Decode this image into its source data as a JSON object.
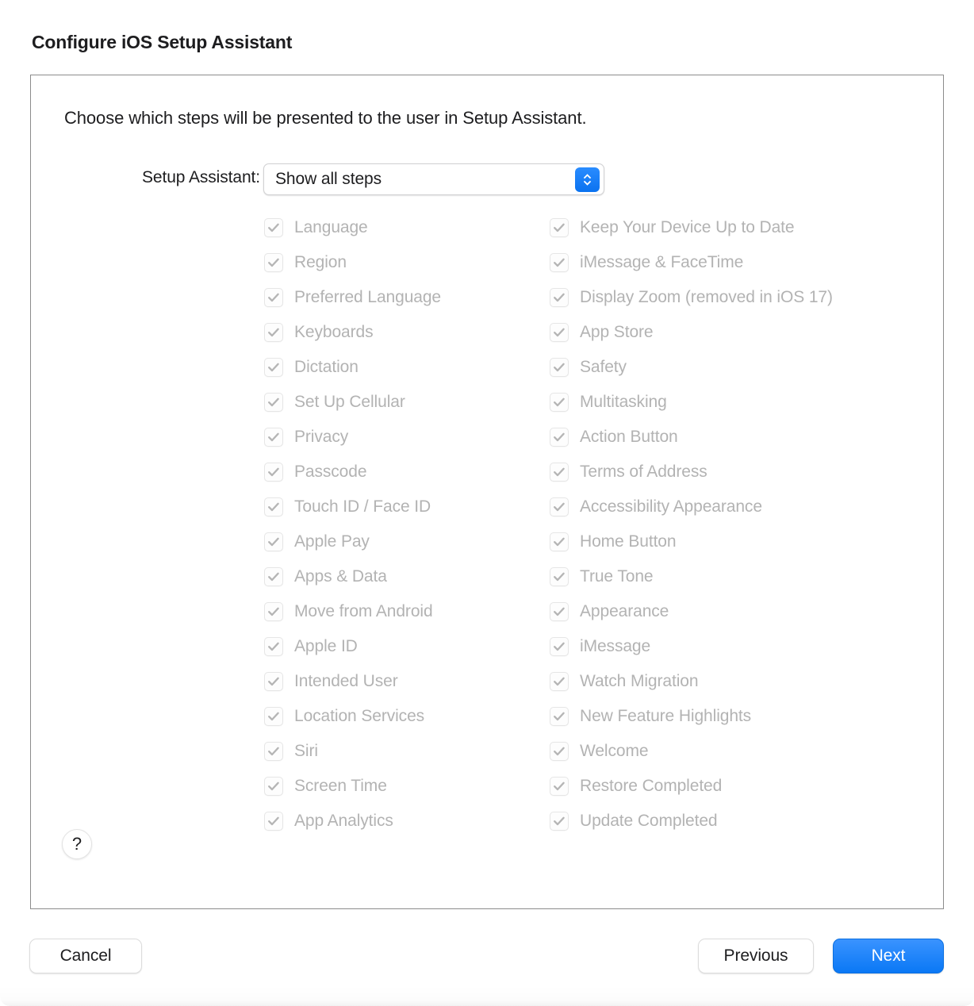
{
  "window": {
    "title": "Configure iOS Setup Assistant"
  },
  "colors": {
    "accent": "#0a78f5",
    "text": "#1d1d1f",
    "disabled_text": "#b3b3b3",
    "box_border": "#8c8c8c"
  },
  "content": {
    "instruction": "Choose which steps will be presented to the user in Setup Assistant.",
    "field_label": "Setup Assistant:",
    "popup_value": "Show all steps",
    "popup_options": [
      "Show all steps"
    ],
    "stepper_icon": "chevron-up-down-icon"
  },
  "steps": {
    "left_column": [
      {
        "label": "Language",
        "checked": true,
        "enabled": false
      },
      {
        "label": "Region",
        "checked": true,
        "enabled": false
      },
      {
        "label": "Preferred Language",
        "checked": true,
        "enabled": false
      },
      {
        "label": "Keyboards",
        "checked": true,
        "enabled": false
      },
      {
        "label": "Dictation",
        "checked": true,
        "enabled": false
      },
      {
        "label": "Set Up Cellular",
        "checked": true,
        "enabled": false
      },
      {
        "label": "Privacy",
        "checked": true,
        "enabled": false
      },
      {
        "label": "Passcode",
        "checked": true,
        "enabled": false
      },
      {
        "label": "Touch ID / Face ID",
        "checked": true,
        "enabled": false
      },
      {
        "label": "Apple Pay",
        "checked": true,
        "enabled": false
      },
      {
        "label": "Apps & Data",
        "checked": true,
        "enabled": false
      },
      {
        "label": "Move from Android",
        "checked": true,
        "enabled": false
      },
      {
        "label": "Apple ID",
        "checked": true,
        "enabled": false
      },
      {
        "label": "Intended User",
        "checked": true,
        "enabled": false
      },
      {
        "label": "Location Services",
        "checked": true,
        "enabled": false
      },
      {
        "label": "Siri",
        "checked": true,
        "enabled": false
      },
      {
        "label": "Screen Time",
        "checked": true,
        "enabled": false
      },
      {
        "label": "App Analytics",
        "checked": true,
        "enabled": false
      }
    ],
    "right_column": [
      {
        "label": "Keep Your Device Up to Date",
        "checked": true,
        "enabled": false
      },
      {
        "label": "iMessage & FaceTime",
        "checked": true,
        "enabled": false
      },
      {
        "label": "Display Zoom (removed in iOS 17)",
        "checked": true,
        "enabled": false
      },
      {
        "label": "App Store",
        "checked": true,
        "enabled": false
      },
      {
        "label": "Safety",
        "checked": true,
        "enabled": false
      },
      {
        "label": "Multitasking",
        "checked": true,
        "enabled": false
      },
      {
        "label": "Action Button",
        "checked": true,
        "enabled": false
      },
      {
        "label": "Terms of Address",
        "checked": true,
        "enabled": false
      },
      {
        "label": "Accessibility Appearance",
        "checked": true,
        "enabled": false
      },
      {
        "label": "Home Button",
        "checked": true,
        "enabled": false
      },
      {
        "label": "True Tone",
        "checked": true,
        "enabled": false
      },
      {
        "label": "Appearance",
        "checked": true,
        "enabled": false
      },
      {
        "label": "iMessage",
        "checked": true,
        "enabled": false
      },
      {
        "label": "Watch Migration",
        "checked": true,
        "enabled": false
      },
      {
        "label": "New Feature Highlights",
        "checked": true,
        "enabled": false
      },
      {
        "label": "Welcome",
        "checked": true,
        "enabled": false
      },
      {
        "label": "Restore Completed",
        "checked": true,
        "enabled": false
      },
      {
        "label": "Update Completed",
        "checked": true,
        "enabled": false
      }
    ]
  },
  "help": {
    "label": "?",
    "icon": "question-mark-icon"
  },
  "footer": {
    "cancel_label": "Cancel",
    "previous_label": "Previous",
    "next_label": "Next"
  }
}
